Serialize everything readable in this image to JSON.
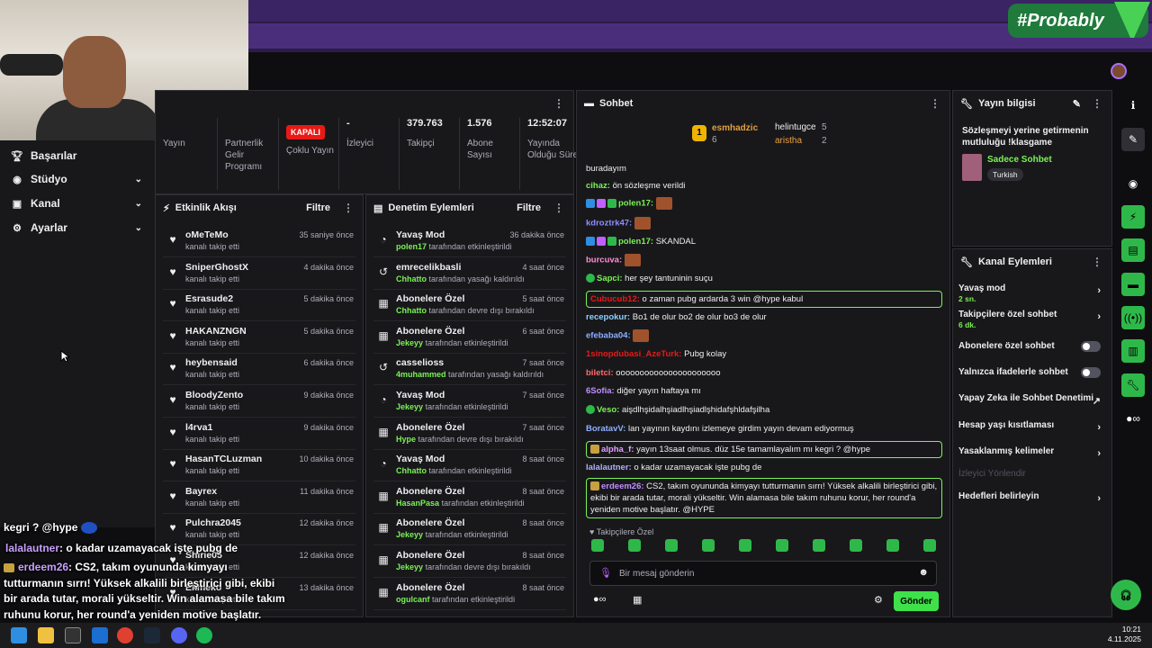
{
  "overlay_logo": "#Probably",
  "sidebar": {
    "items": [
      {
        "label": "Başarılar",
        "icon": "trophy-icon"
      },
      {
        "label": "Stüdyo",
        "icon": "studio-icon"
      },
      {
        "label": "Kanal",
        "icon": "channel-icon"
      },
      {
        "label": "Ayarlar",
        "icon": "gear-icon"
      }
    ]
  },
  "stats": {
    "yayin": "Yayın",
    "partner": "Partnerlik Gelir Programı",
    "kapali": "KAPALI",
    "coklu": "Çoklu Yayın",
    "izleyici_value": "-",
    "izleyici": "İzleyici",
    "takipci_value": "379.763",
    "takipci": "Takipçi",
    "abone_value": "1.576",
    "abone": "Abone Sayısı",
    "sure_value": "12:52:07",
    "sure": "Yayında Olduğu Süre"
  },
  "activity": {
    "title": "Etkinlik Akışı",
    "filter": "Filtre",
    "items": [
      {
        "name": "oMeTeMo",
        "sub": "kanalı takip etti",
        "time": "35 saniye önce"
      },
      {
        "name": "SniperGhostX",
        "sub": "kanalı takip etti",
        "time": "4 dakika önce"
      },
      {
        "name": "Esrasude2",
        "sub": "kanalı takip etti",
        "time": "5 dakika önce"
      },
      {
        "name": "HAKANZNGN",
        "sub": "kanalı takip etti",
        "time": "5 dakika önce"
      },
      {
        "name": "heybensaid",
        "sub": "kanalı takip etti",
        "time": "6 dakika önce"
      },
      {
        "name": "BloodyZento",
        "sub": "kanalı takip etti",
        "time": "9 dakika önce"
      },
      {
        "name": "l4rva1",
        "sub": "kanalı takip etti",
        "time": "9 dakika önce"
      },
      {
        "name": "HasanTCLuzman",
        "sub": "kanalı takip etti",
        "time": "10 dakika önce"
      },
      {
        "name": "Bayrex",
        "sub": "kanalı takip etti",
        "time": "11 dakika önce"
      },
      {
        "name": "Pulchra2045",
        "sub": "kanalı takip etti",
        "time": "12 dakika önce"
      },
      {
        "name": "Shirie05",
        "sub": "kanalı takip etti",
        "time": "12 dakika önce"
      },
      {
        "name": "Ekmeko",
        "sub": "kanalı takip etti",
        "time": "13 dakika önce"
      }
    ]
  },
  "moderation": {
    "title": "Denetim Eylemleri",
    "filter": "Filtre",
    "items": [
      {
        "name": "Yavaş Mod",
        "user": "polen17",
        "action": "tarafından etkinleştirildi",
        "time": "36 dakika önce"
      },
      {
        "name": "emrecelikbasli",
        "user": "Chhatto",
        "action": "tarafından yasağı kaldırıldı",
        "time": "4 saat önce"
      },
      {
        "name": "Abonelere Özel",
        "user": "Chhatto",
        "action": "tarafından devre dışı bırakıldı",
        "time": "5 saat önce"
      },
      {
        "name": "Abonelere Özel",
        "user": "Jekeyy",
        "action": "tarafından etkinleştirildi",
        "time": "6 saat önce"
      },
      {
        "name": "casselioss",
        "user": "4muhammed",
        "action": "tarafından yasağı kaldırıldı",
        "time": "7 saat önce"
      },
      {
        "name": "Yavaş Mod",
        "user": "Jekeyy",
        "action": "tarafından etkinleştirildi",
        "time": "7 saat önce"
      },
      {
        "name": "Abonelere Özel",
        "user": "Hype",
        "action": "tarafından devre dışı bırakıldı",
        "time": "7 saat önce"
      },
      {
        "name": "Yavaş Mod",
        "user": "Chhatto",
        "action": "tarafından etkinleştirildi",
        "time": "8 saat önce"
      },
      {
        "name": "Abonelere Özel",
        "user": "HasanPasa",
        "action": "tarafından etkinleştirildi",
        "time": "8 saat önce"
      },
      {
        "name": "Abonelere Özel",
        "user": "Jekeyy",
        "action": "tarafından etkinleştirildi",
        "time": "8 saat önce"
      },
      {
        "name": "Abonelere Özel",
        "user": "Jekeyy",
        "action": "tarafından devre dışı bırakıldı",
        "time": "8 saat önce"
      },
      {
        "name": "Abonelere Özel",
        "user": "ogulcanf",
        "action": "tarafından etkinleştirildi",
        "time": "8 saat önce"
      }
    ]
  },
  "chat": {
    "title": "Sohbet",
    "leader1": "esmhadzic",
    "leader1_count": "6",
    "leader2": "helintugce",
    "leader2_count": "5",
    "leader3": "aristha",
    "leader3_count": "2",
    "messages": [
      {
        "user": "",
        "text": "buradayım",
        "color": "#efeff1"
      },
      {
        "user": "cihaz:",
        "text": " ön sözleşme verildi",
        "color": "#7bf155"
      },
      {
        "user": "polen17:",
        "text": "",
        "color": "#7bf155"
      },
      {
        "user": "kdroztrk47:",
        "text": "",
        "color": "#8f8fff"
      },
      {
        "user": "polen17:",
        "text": " SKANDAL",
        "color": "#7bf155"
      },
      {
        "user": "burcuva:",
        "text": "",
        "color": "#ff8fd0"
      },
      {
        "user": "Sapci:",
        "text": " her şey tantuninin suçu",
        "color": "#7bf155"
      },
      {
        "user": "Cubucub12:",
        "text": " o zaman pubg ardarda 3 win @hype kabul",
        "color": "#e91916"
      },
      {
        "user": "recepokur:",
        "text": " Bo1 de olur bo2 de olur bo3 de olur",
        "color": "#8fd0ff"
      },
      {
        "user": "efebaba04:",
        "text": "",
        "color": "#8fb0ff"
      },
      {
        "user": "1sinopdubasi_AzeTurk:",
        "text": " Pubg kolay",
        "color": "#e91916"
      },
      {
        "user": "biletci:",
        "text": " oooooooooooooooooooooo",
        "color": "#ff6b6b"
      },
      {
        "user": "6Sofia:",
        "text": " diğer yayın haftaya mı",
        "color": "#c08fff"
      },
      {
        "user": "Veso:",
        "text": " aişdlhşidalhşiadlhşiadlşhidafşhldafşilha",
        "color": "#7bf155"
      },
      {
        "user": "BoratavV:",
        "text": " lan yayının kaydını izlemeye girdim yayın devam ediyormuş",
        "color": "#8fb0ff"
      },
      {
        "user": "alpha_f:",
        "text": " yayın 13saat olmus. düz 15e tamamlayalım mı kegri ? @hype",
        "color": "#e0a0ff"
      },
      {
        "user": "lalalautner:",
        "text": " o kadar uzamayacak işte pubg de",
        "color": "#b0b0ff"
      },
      {
        "user": "erdeem26:",
        "text": " CS2, takım oyununda kimyayı tutturmanın sırrı! Yüksek alkalili birleştirici gibi, ekibi bir arada tutar, morali yükseltir. Win alamasa bile takım ruhunu korur, her round'a yeniden motive başlatır. @HYPE",
        "color": "#c08fff"
      }
    ],
    "emote_label": "Takipçilere Özel",
    "placeholder": "Bir mesaj gönderin",
    "send": "Gönder"
  },
  "info": {
    "title": "Yayın bilgisi",
    "stream_title": "Sözleşmeyi yerine getirmenin mutluluğu !klasgame",
    "category": "Sadece Sohbet",
    "tag": "Turkish"
  },
  "actions": {
    "title": "Kanal Eylemleri",
    "slow": "Yavaş mod",
    "slow_sub": "2 sn.",
    "followers": "Takipçilere özel sohbet",
    "followers_sub": "6 dk.",
    "subs": "Abonelere özel sohbet",
    "emotes": "Yalnızca ifadelerle sohbet",
    "ai": "Yapay Zeka ile Sohbet Denetimi",
    "age": "Hesap yaşı kısıtlaması",
    "banned": "Yasaklanmış kelimeler",
    "raid": "İzleyici Yönlendir",
    "goals": "Hedefleri belirleyin"
  },
  "overlay_chat": {
    "line1": "kegri ? @hype",
    "line2_user": "lalalautner",
    "line2_text": ": o kadar uzamayacak işte pubg de",
    "line3_user": "erdeem26",
    "line3_text": ": CS2, takım oyununda kimyayı tutturmanın sırrı! Yüksek alkalili birleştirici gibi, ekibi bir arada tutar, morali yükseltir. Win alamasa bile takım ruhunu korur, her round'a yeniden motive başlatır. @HYPE"
  },
  "clock": {
    "time": "10:21",
    "date": "4.11.2025"
  }
}
